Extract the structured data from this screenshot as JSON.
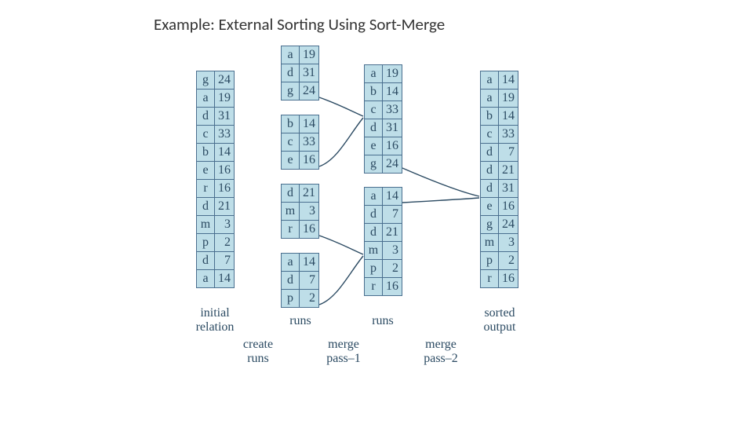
{
  "title": "Example: External Sorting Using Sort-Merge",
  "initial": [
    {
      "k": "g",
      "v": 24
    },
    {
      "k": "a",
      "v": 19
    },
    {
      "k": "d",
      "v": 31
    },
    {
      "k": "c",
      "v": 33
    },
    {
      "k": "b",
      "v": 14
    },
    {
      "k": "e",
      "v": 16
    },
    {
      "k": "r",
      "v": 16
    },
    {
      "k": "d",
      "v": 21
    },
    {
      "k": "m",
      "v": 3
    },
    {
      "k": "p",
      "v": 2
    },
    {
      "k": "d",
      "v": 7
    },
    {
      "k": "a",
      "v": 14
    }
  ],
  "runs1": [
    [
      {
        "k": "a",
        "v": 19
      },
      {
        "k": "d",
        "v": 31
      },
      {
        "k": "g",
        "v": 24
      }
    ],
    [
      {
        "k": "b",
        "v": 14
      },
      {
        "k": "c",
        "v": 33
      },
      {
        "k": "e",
        "v": 16
      }
    ],
    [
      {
        "k": "d",
        "v": 21
      },
      {
        "k": "m",
        "v": 3
      },
      {
        "k": "r",
        "v": 16
      }
    ],
    [
      {
        "k": "a",
        "v": 14
      },
      {
        "k": "d",
        "v": 7
      },
      {
        "k": "p",
        "v": 2
      }
    ]
  ],
  "runs2": [
    [
      {
        "k": "a",
        "v": 19
      },
      {
        "k": "b",
        "v": 14
      },
      {
        "k": "c",
        "v": 33
      },
      {
        "k": "d",
        "v": 31
      },
      {
        "k": "e",
        "v": 16
      },
      {
        "k": "g",
        "v": 24
      }
    ],
    [
      {
        "k": "a",
        "v": 14
      },
      {
        "k": "d",
        "v": 7
      },
      {
        "k": "d",
        "v": 21
      },
      {
        "k": "m",
        "v": 3
      },
      {
        "k": "p",
        "v": 2
      },
      {
        "k": "r",
        "v": 16
      }
    ]
  ],
  "sorted": [
    {
      "k": "a",
      "v": 14
    },
    {
      "k": "a",
      "v": 19
    },
    {
      "k": "b",
      "v": 14
    },
    {
      "k": "c",
      "v": 33
    },
    {
      "k": "d",
      "v": 7
    },
    {
      "k": "d",
      "v": 21
    },
    {
      "k": "d",
      "v": 31
    },
    {
      "k": "e",
      "v": 16
    },
    {
      "k": "g",
      "v": 24
    },
    {
      "k": "m",
      "v": 3
    },
    {
      "k": "p",
      "v": 2
    },
    {
      "k": "r",
      "v": 16
    }
  ],
  "labels": {
    "initial": "initial\nrelation",
    "runs": "runs",
    "create": "create\nruns",
    "mp1": "merge\npass–1",
    "mp2": "merge\npass–2",
    "sorted": "sorted\noutput"
  }
}
